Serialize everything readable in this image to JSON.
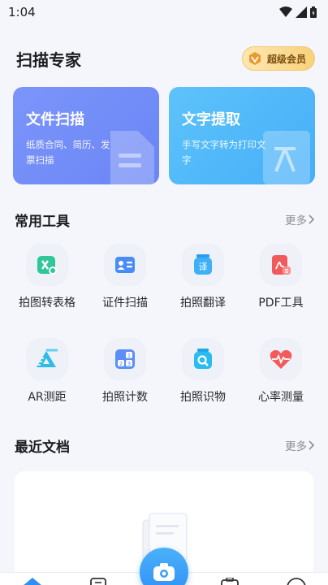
{
  "status_bar": {
    "time": "1:04"
  },
  "header": {
    "title": "扫描专家",
    "vip_label": "超级会员"
  },
  "cards": [
    {
      "title": "文件扫描",
      "subtitle": "纸质合同、简历、发票扫描"
    },
    {
      "title": "文字提取",
      "subtitle": "手写文字转为打印文字"
    }
  ],
  "tools_section": {
    "title": "常用工具",
    "more": "更多",
    "items": [
      {
        "label": "拍图转表格",
        "icon": "excel-icon"
      },
      {
        "label": "证件扫描",
        "icon": "id-card-icon"
      },
      {
        "label": "拍照翻译",
        "icon": "translate-icon"
      },
      {
        "label": "PDF工具",
        "icon": "pdf-icon"
      },
      {
        "label": "AR测距",
        "icon": "ruler-icon"
      },
      {
        "label": "拍照计数",
        "icon": "counter-icon"
      },
      {
        "label": "拍照识物",
        "icon": "object-search-icon"
      },
      {
        "label": "心率测量",
        "icon": "heart-rate-icon"
      }
    ]
  },
  "recent_section": {
    "title": "最近文档",
    "more": "更多"
  },
  "colors": {
    "primary": "#2f8ff4",
    "scan_card": "#6f8bf8",
    "text_card": "#4fb6f9",
    "vip_gold": "#f8d27a"
  }
}
